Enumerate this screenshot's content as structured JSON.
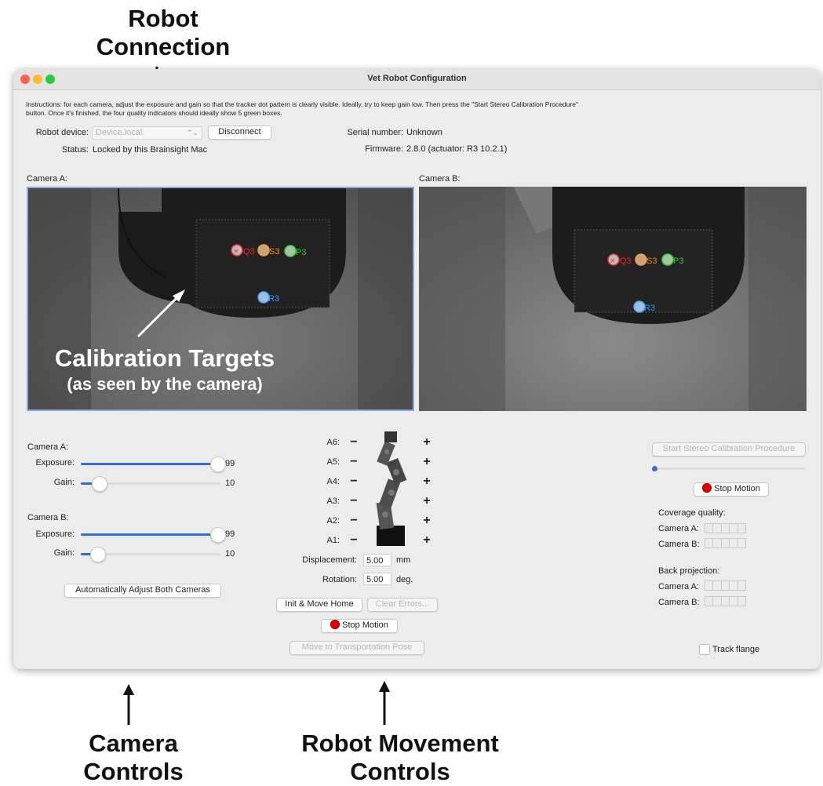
{
  "annotations": {
    "robot_connection": "Robot\nConnection",
    "calibration_targets": "Calibration Targets",
    "calibration_targets_sub": "(as seen by the camera)",
    "camera_controls": "Camera\nControls",
    "robot_movement_controls": "Robot Movement\nControls"
  },
  "window": {
    "title": "Vet Robot Configuration",
    "instructions": "Instructions: for each camera, adjust the exposure and gain so that the tracker dot pattern is clearly visible. Ideally, try to keep gain low. Then press the \"Start Stereo Calibration Procedure\" button. Once it's finished, the four quality indicators should ideally show 5 green boxes."
  },
  "connection": {
    "robot_device_label": "Robot device:",
    "robot_device_value": "Device.local.",
    "disconnect_label": "Disconnect",
    "status_label": "Status:",
    "status_value": "Locked by this Brainsight Mac",
    "serial_label": "Serial number:",
    "serial_value": "Unknown",
    "firmware_label": "Firmware:",
    "firmware_value": "2.8.0 (actuator: R3 10.2.1)"
  },
  "cameras": {
    "a_label": "Camera A:",
    "b_label": "Camera B:",
    "markers": [
      "Q3",
      "S3",
      "P3",
      "R3"
    ]
  },
  "camera_controls": {
    "camera_a_label": "Camera A:",
    "camera_b_label": "Camera B:",
    "exposure_label": "Exposure:",
    "gain_label": "Gain:",
    "a_exposure": "99",
    "a_gain": "10",
    "b_exposure": "99",
    "b_gain": "10",
    "a_exposure_fraction": 0.98,
    "a_gain_fraction": 0.13,
    "b_exposure_fraction": 0.98,
    "b_gain_fraction": 0.12,
    "auto_adjust_label": "Automatically Adjust Both Cameras"
  },
  "robot_controls": {
    "axes": [
      "A6:",
      "A5:",
      "A4:",
      "A3:",
      "A2:",
      "A1:"
    ],
    "minus": "−",
    "plus": "+",
    "displacement_label": "Displacement:",
    "displacement_value": "5.00",
    "displacement_unit": "mm",
    "rotation_label": "Rotation:",
    "rotation_value": "5.00",
    "rotation_unit": "deg.",
    "init_move_home": "Init & Move Home",
    "clear_errors": "Clear Errors...",
    "stop_motion": "Stop Motion",
    "transport_pose": "Move to Transportation Pose"
  },
  "calibration": {
    "start_label": "Start Stereo Calibration Procedure",
    "progress_fraction": 0.01,
    "stop_motion": "Stop Motion",
    "coverage_quality_label": "Coverage quality:",
    "back_projection_label": "Back projection:",
    "camera_a_label": "Camera A:",
    "camera_b_label": "Camera B:",
    "track_flange_label": "Track flange"
  }
}
